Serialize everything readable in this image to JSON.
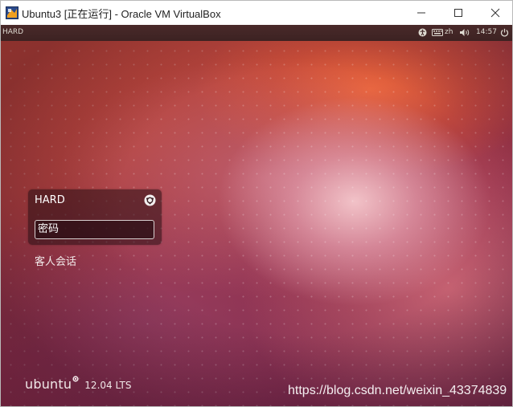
{
  "window": {
    "title": "Ubuntu3 [正在运行] - Oracle VM VirtualBox",
    "icon": "virtualbox-icon",
    "controls": [
      "minimize-icon",
      "maximize-icon",
      "close-icon"
    ]
  },
  "top_panel": {
    "hostname": "HARD",
    "input_language": "zh",
    "clock": "14:57",
    "indicators": [
      "accessibility-icon",
      "keyboard-icon",
      "volume-icon",
      "power-icon"
    ]
  },
  "login": {
    "username": "HARD",
    "session_icon": "session-options-icon",
    "password_placeholder": "密码",
    "guest_session_label": "客人会话"
  },
  "branding": {
    "wordmark": "ubuntu",
    "version": "12.04 LTS"
  },
  "watermark": "https://blog.csdn.net/weixin_43374839",
  "colors": {
    "panel_bg": "#3c2222",
    "accent_orange": "#e95420"
  }
}
